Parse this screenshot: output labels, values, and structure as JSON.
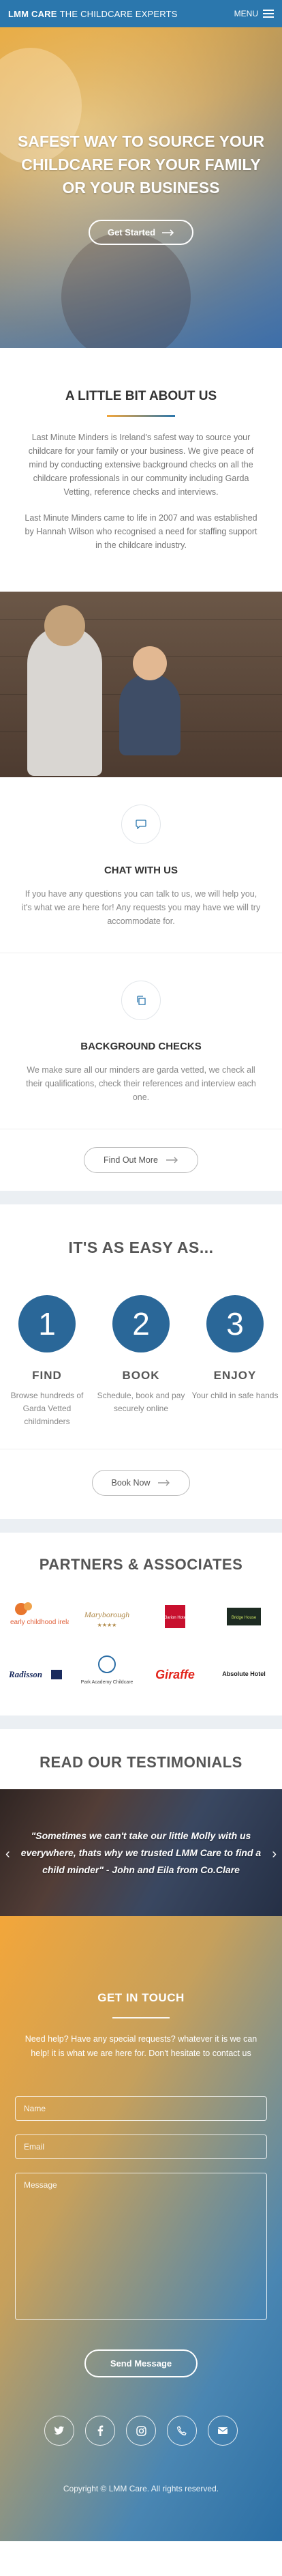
{
  "nav": {
    "brand_bold": "LMM CARE",
    "brand_rest": "THE CHILDCARE EXPERTS",
    "menu_label": "MENU"
  },
  "hero": {
    "headline": "Safest way to source your childcare for your family or your business",
    "cta": "Get Started"
  },
  "about": {
    "title": "A Little Bit About Us",
    "p1": "Last Minute Minders is Ireland's safest way to source your childcare for your family or your business. We give peace of mind by conducting extensive background checks on all the childcare professionals in our community including Garda Vetting, reference checks and interviews.",
    "p2": "Last Minute Minders came to life in 2007 and was established by Hannah Wilson who recognised a need for staffing support in the childcare industry."
  },
  "features": [
    {
      "icon": "chat-bubble-icon",
      "title": "Chat With Us",
      "text": "If you have any questions you can talk to us, we will help you, it's what we are here for! Any requests you may have we will try accommodate for."
    },
    {
      "icon": "copy-documents-icon",
      "title": "Background Checks",
      "text": "We make sure all our minders are garda vetted, we check all their qualifications, check their references and interview each one."
    }
  ],
  "find_out_more": "Find Out More",
  "easy": {
    "title": "It's As Easy As...",
    "steps": [
      {
        "num": "1",
        "title": "Find",
        "text": "Browse hundreds of Garda Vetted childminders"
      },
      {
        "num": "2",
        "title": "Book",
        "text": "Schedule, book and pay securely online"
      },
      {
        "num": "3",
        "title": "Enjoy",
        "text": "Your child in safe hands"
      }
    ]
  },
  "book_now": "Book Now",
  "partners": {
    "title": "Partners & Associates",
    "logos": [
      "early childhood ireland",
      "Maryborough",
      "Clarion Hotel",
      "Bridge House",
      "Radisson",
      "Park Academy Childcare",
      "Giraffe",
      "Absolute Hotel"
    ]
  },
  "testimonials": {
    "title": "Read Our Testimonials",
    "quote": "\"Sometimes we can't take our little Molly with us everywhere, thats why we trusted LMM Care to find a child minder\" - John and Eila from Co.Clare"
  },
  "contact": {
    "title": "Get In Touch",
    "intro": "Need help? Have any special requests? whatever it is we can help! it is what we are here for. Don't hesitate to contact us",
    "name_placeholder": "Name",
    "email_placeholder": "Email",
    "message_placeholder": "Message",
    "send": "Send Message",
    "social_icons": [
      "twitter-icon",
      "facebook-icon",
      "instagram-icon",
      "phone-icon",
      "email-icon"
    ]
  },
  "footer": {
    "copyright": "Copyright © LMM Care. All rights reserved."
  },
  "colors": {
    "primary_blue": "#2b77ad",
    "accent_orange": "#f3a63a",
    "step_blue": "#2a6798"
  }
}
